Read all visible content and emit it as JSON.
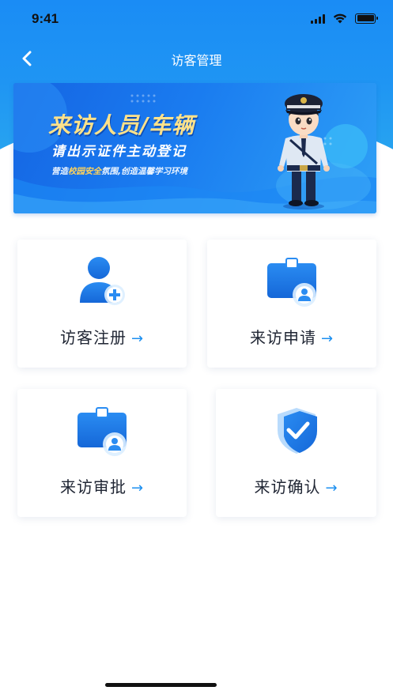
{
  "status_bar": {
    "time": "9:41"
  },
  "nav": {
    "title": "访客管理"
  },
  "banner": {
    "title": "来访人员/车辆",
    "subtitle": "请出示证件主动登记",
    "slogan_prefix": "营造",
    "slogan_highlight": "校园安全",
    "slogan_suffix": "氛围,创造温馨学习环境"
  },
  "cards": [
    {
      "label": "访客注册",
      "icon": "user-add-icon",
      "arrow": "→"
    },
    {
      "label": "来访申请",
      "icon": "id-badge-icon",
      "arrow": "→"
    },
    {
      "label": "来访审批",
      "icon": "id-badge-icon",
      "arrow": "→"
    },
    {
      "label": "来访确认",
      "icon": "shield-check-icon",
      "arrow": "→"
    }
  ],
  "colors": {
    "header_gradient_start": "#1a8cf5",
    "header_gradient_end": "#27a3f0",
    "accent": "#1b8ff0",
    "banner_title": "#ffe28a",
    "label_text": "#1f2533"
  }
}
